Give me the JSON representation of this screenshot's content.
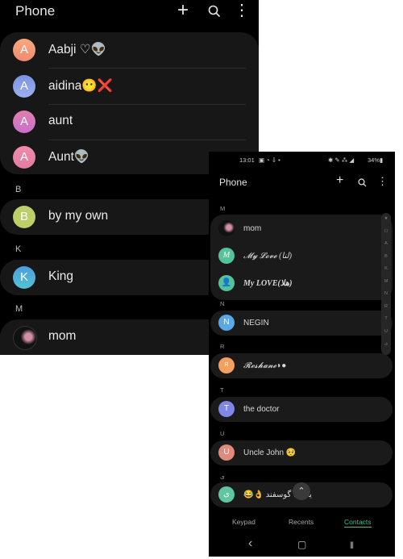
{
  "left_screen": {
    "header": {
      "title": "Phone",
      "add_icon": "+",
      "search_icon": "⌕",
      "more_icon": "⋮"
    },
    "groups": [
      {
        "letter": "",
        "contacts": [
          {
            "initial": "A",
            "name": "Aabji ♡👽",
            "color": "#f59a74"
          },
          {
            "initial": "A",
            "name": "aidina😶❌",
            "color": "#8a9ee6"
          },
          {
            "initial": "A",
            "name": "aunt",
            "color": "#d57bb9"
          },
          {
            "initial": "A",
            "name": "Aunt👽",
            "color": "#e886a6"
          }
        ]
      },
      {
        "letter": "B",
        "contacts": [
          {
            "initial": "B",
            "name": "by my own",
            "color": "#bccf68"
          }
        ]
      },
      {
        "letter": "K",
        "contacts": [
          {
            "initial": "K",
            "name": "King",
            "color": "#4fb0d9"
          }
        ]
      },
      {
        "letter": "M",
        "contacts": [
          {
            "initial": "",
            "name": "mom",
            "color": "#111111"
          }
        ]
      }
    ]
  },
  "right_screen": {
    "status_bar": {
      "time": "13:01",
      "left_icons": "▣ ◔ ⇩ •",
      "right_icons": "✱ ✎ ⁂ ◢",
      "battery": "34%▮"
    },
    "header": {
      "title": "Phone",
      "add_icon": "+",
      "search_icon": "⌕",
      "more_icon": "⋮"
    },
    "groups": [
      {
        "letter": "M",
        "contacts": [
          {
            "initial": "",
            "name": "mom",
            "color": "#111111"
          },
          {
            "initial": "M",
            "name": "𝓜𝔂 𝓛𝓸𝓿𝓮 (لنا)",
            "color": "#54c39a"
          },
          {
            "initial": "👤",
            "name": "My LOVE(هلا)",
            "color": "#54c39a"
          }
        ]
      },
      {
        "letter": "N",
        "contacts": [
          {
            "initial": "N",
            "name": "NEGIN",
            "color": "#5aa9e6"
          }
        ]
      },
      {
        "letter": "R",
        "contacts": [
          {
            "initial": "R",
            "name": "𝓡𝓮𝓼𝓱𝓪𝓷𝓮◗●",
            "color": "#f5a05e"
          }
        ]
      },
      {
        "letter": "T",
        "contacts": [
          {
            "initial": "T",
            "name": "the doctor",
            "color": "#7f86e8"
          }
        ]
      },
      {
        "letter": "U",
        "contacts": [
          {
            "initial": "U",
            "name": "Uncle John 🥺",
            "color": "#e0897d"
          }
        ]
      },
      {
        "letter": "ی",
        "contacts": [
          {
            "initial": "ی",
            "name": "😂👌 یک ... گوسفند",
            "color": "#5fc7a0"
          }
        ]
      }
    ],
    "index_scroller": [
      "★",
      "☐",
      "A",
      "B",
      "K",
      "M",
      "N",
      "R",
      "T",
      "U",
      "ی"
    ],
    "scroll_top_icon": "⌃",
    "tabs": [
      {
        "label": "Keypad",
        "active": false
      },
      {
        "label": "Recents",
        "active": false
      },
      {
        "label": "Contacts",
        "active": true
      }
    ],
    "nav": {
      "back": "‹",
      "home": "▢",
      "recents": "|||"
    },
    "accent_color": "#3fbf86"
  }
}
